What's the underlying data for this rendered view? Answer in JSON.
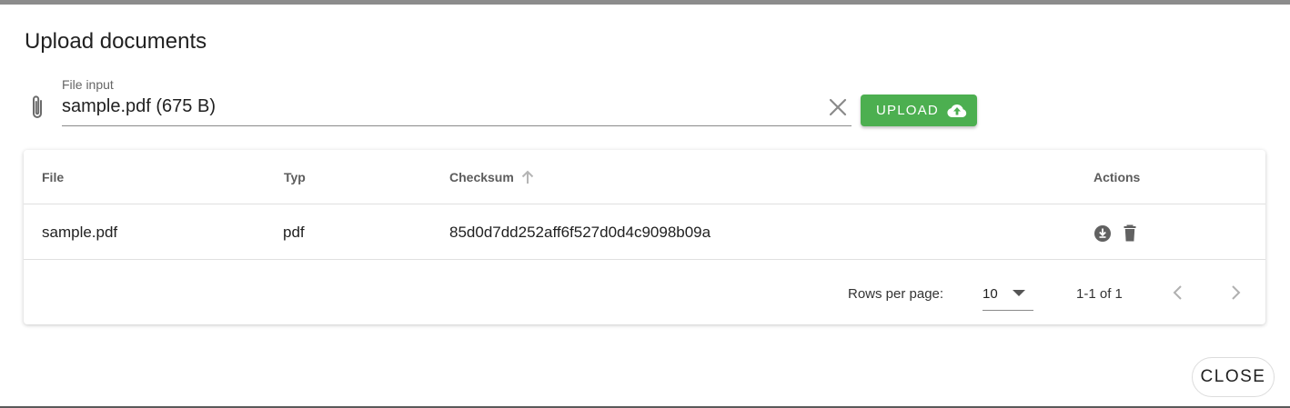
{
  "dialog": {
    "title": "Upload documents"
  },
  "file_input": {
    "label": "File input",
    "value": "sample.pdf (675 B)",
    "icon": "paperclip-icon",
    "clear_icon": "close-icon"
  },
  "upload_button": {
    "label": "UPLOAD",
    "icon": "cloud-upload-icon",
    "color": "#4caf50"
  },
  "table": {
    "columns": [
      "File",
      "Typ",
      "Checksum",
      "Actions"
    ],
    "sort": {
      "column": "Checksum",
      "direction": "ascending",
      "icon": "arrow-up-icon"
    },
    "rows": [
      {
        "file": "sample.pdf",
        "type": "pdf",
        "checksum": "85d0d7dd252aff6f527d0d4c9098b09a",
        "actions": [
          "download-icon",
          "delete-icon"
        ]
      }
    ],
    "footer": {
      "rows_per_page_label": "Rows per page:",
      "rows_per_page_value": "10",
      "range": "1-1 of 1"
    }
  },
  "close_button": {
    "label": "CLOSE"
  }
}
